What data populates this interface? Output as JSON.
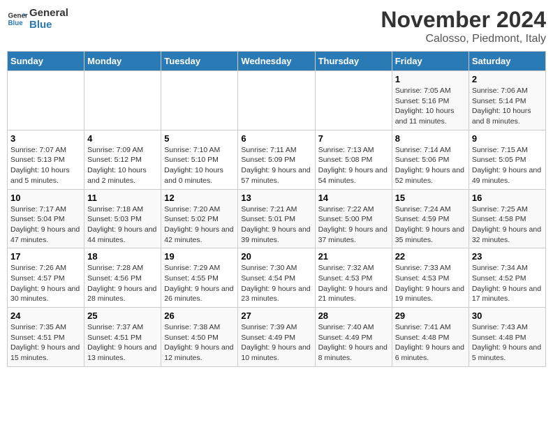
{
  "logo": {
    "text_general": "General",
    "text_blue": "Blue"
  },
  "header": {
    "month_year": "November 2024",
    "location": "Calosso, Piedmont, Italy"
  },
  "days_of_week": [
    "Sunday",
    "Monday",
    "Tuesday",
    "Wednesday",
    "Thursday",
    "Friday",
    "Saturday"
  ],
  "weeks": [
    [
      {
        "day": "",
        "info": ""
      },
      {
        "day": "",
        "info": ""
      },
      {
        "day": "",
        "info": ""
      },
      {
        "day": "",
        "info": ""
      },
      {
        "day": "",
        "info": ""
      },
      {
        "day": "1",
        "info": "Sunrise: 7:05 AM\nSunset: 5:16 PM\nDaylight: 10 hours and 11 minutes."
      },
      {
        "day": "2",
        "info": "Sunrise: 7:06 AM\nSunset: 5:14 PM\nDaylight: 10 hours and 8 minutes."
      }
    ],
    [
      {
        "day": "3",
        "info": "Sunrise: 7:07 AM\nSunset: 5:13 PM\nDaylight: 10 hours and 5 minutes."
      },
      {
        "day": "4",
        "info": "Sunrise: 7:09 AM\nSunset: 5:12 PM\nDaylight: 10 hours and 2 minutes."
      },
      {
        "day": "5",
        "info": "Sunrise: 7:10 AM\nSunset: 5:10 PM\nDaylight: 10 hours and 0 minutes."
      },
      {
        "day": "6",
        "info": "Sunrise: 7:11 AM\nSunset: 5:09 PM\nDaylight: 9 hours and 57 minutes."
      },
      {
        "day": "7",
        "info": "Sunrise: 7:13 AM\nSunset: 5:08 PM\nDaylight: 9 hours and 54 minutes."
      },
      {
        "day": "8",
        "info": "Sunrise: 7:14 AM\nSunset: 5:06 PM\nDaylight: 9 hours and 52 minutes."
      },
      {
        "day": "9",
        "info": "Sunrise: 7:15 AM\nSunset: 5:05 PM\nDaylight: 9 hours and 49 minutes."
      }
    ],
    [
      {
        "day": "10",
        "info": "Sunrise: 7:17 AM\nSunset: 5:04 PM\nDaylight: 9 hours and 47 minutes."
      },
      {
        "day": "11",
        "info": "Sunrise: 7:18 AM\nSunset: 5:03 PM\nDaylight: 9 hours and 44 minutes."
      },
      {
        "day": "12",
        "info": "Sunrise: 7:20 AM\nSunset: 5:02 PM\nDaylight: 9 hours and 42 minutes."
      },
      {
        "day": "13",
        "info": "Sunrise: 7:21 AM\nSunset: 5:01 PM\nDaylight: 9 hours and 39 minutes."
      },
      {
        "day": "14",
        "info": "Sunrise: 7:22 AM\nSunset: 5:00 PM\nDaylight: 9 hours and 37 minutes."
      },
      {
        "day": "15",
        "info": "Sunrise: 7:24 AM\nSunset: 4:59 PM\nDaylight: 9 hours and 35 minutes."
      },
      {
        "day": "16",
        "info": "Sunrise: 7:25 AM\nSunset: 4:58 PM\nDaylight: 9 hours and 32 minutes."
      }
    ],
    [
      {
        "day": "17",
        "info": "Sunrise: 7:26 AM\nSunset: 4:57 PM\nDaylight: 9 hours and 30 minutes."
      },
      {
        "day": "18",
        "info": "Sunrise: 7:28 AM\nSunset: 4:56 PM\nDaylight: 9 hours and 28 minutes."
      },
      {
        "day": "19",
        "info": "Sunrise: 7:29 AM\nSunset: 4:55 PM\nDaylight: 9 hours and 26 minutes."
      },
      {
        "day": "20",
        "info": "Sunrise: 7:30 AM\nSunset: 4:54 PM\nDaylight: 9 hours and 23 minutes."
      },
      {
        "day": "21",
        "info": "Sunrise: 7:32 AM\nSunset: 4:53 PM\nDaylight: 9 hours and 21 minutes."
      },
      {
        "day": "22",
        "info": "Sunrise: 7:33 AM\nSunset: 4:53 PM\nDaylight: 9 hours and 19 minutes."
      },
      {
        "day": "23",
        "info": "Sunrise: 7:34 AM\nSunset: 4:52 PM\nDaylight: 9 hours and 17 minutes."
      }
    ],
    [
      {
        "day": "24",
        "info": "Sunrise: 7:35 AM\nSunset: 4:51 PM\nDaylight: 9 hours and 15 minutes."
      },
      {
        "day": "25",
        "info": "Sunrise: 7:37 AM\nSunset: 4:51 PM\nDaylight: 9 hours and 13 minutes."
      },
      {
        "day": "26",
        "info": "Sunrise: 7:38 AM\nSunset: 4:50 PM\nDaylight: 9 hours and 12 minutes."
      },
      {
        "day": "27",
        "info": "Sunrise: 7:39 AM\nSunset: 4:49 PM\nDaylight: 9 hours and 10 minutes."
      },
      {
        "day": "28",
        "info": "Sunrise: 7:40 AM\nSunset: 4:49 PM\nDaylight: 9 hours and 8 minutes."
      },
      {
        "day": "29",
        "info": "Sunrise: 7:41 AM\nSunset: 4:48 PM\nDaylight: 9 hours and 6 minutes."
      },
      {
        "day": "30",
        "info": "Sunrise: 7:43 AM\nSunset: 4:48 PM\nDaylight: 9 hours and 5 minutes."
      }
    ]
  ]
}
